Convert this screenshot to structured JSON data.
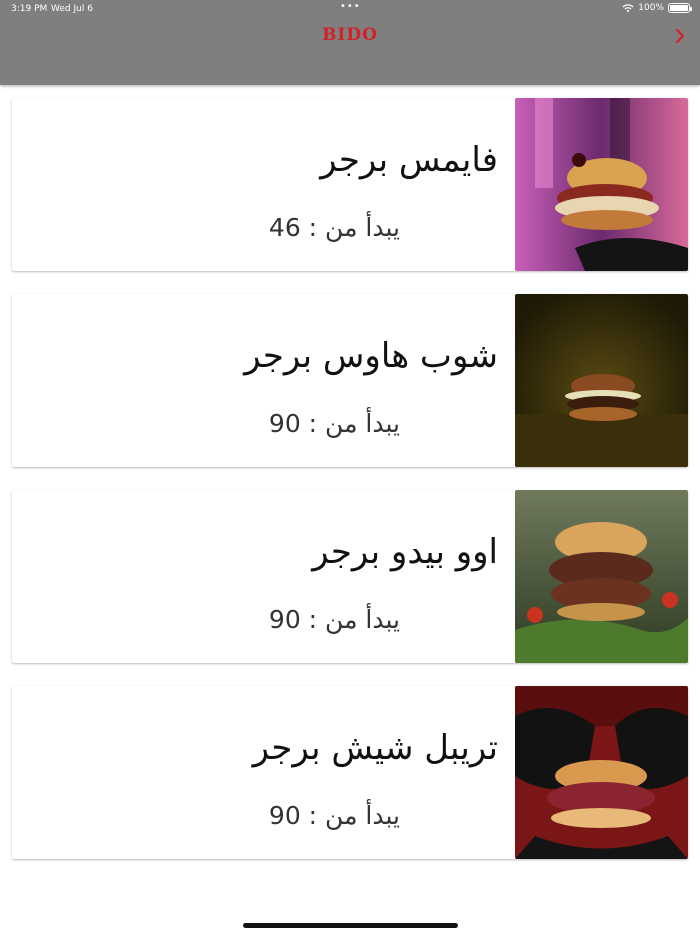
{
  "status_bar": {
    "time": "3:19 PM",
    "date": "Wed Jul 6",
    "dots": "•••",
    "battery": "100%",
    "battery_level": 1.0
  },
  "header": {
    "logo": "BIDO",
    "back_icon": "chevron-right-icon",
    "accent": "#d42027",
    "background": "#7f7f7f"
  },
  "items": [
    {
      "name": "فايمس برجر",
      "price": "يبدأ من : 46"
    },
    {
      "name": "شوب هاوس برجر",
      "price": "يبدأ من : 90"
    },
    {
      "name": "اوو بيدو برجر",
      "price": "يبدأ من : 90"
    },
    {
      "name": "تريبل شيش برجر",
      "price": "يبدأ من : 90"
    }
  ]
}
